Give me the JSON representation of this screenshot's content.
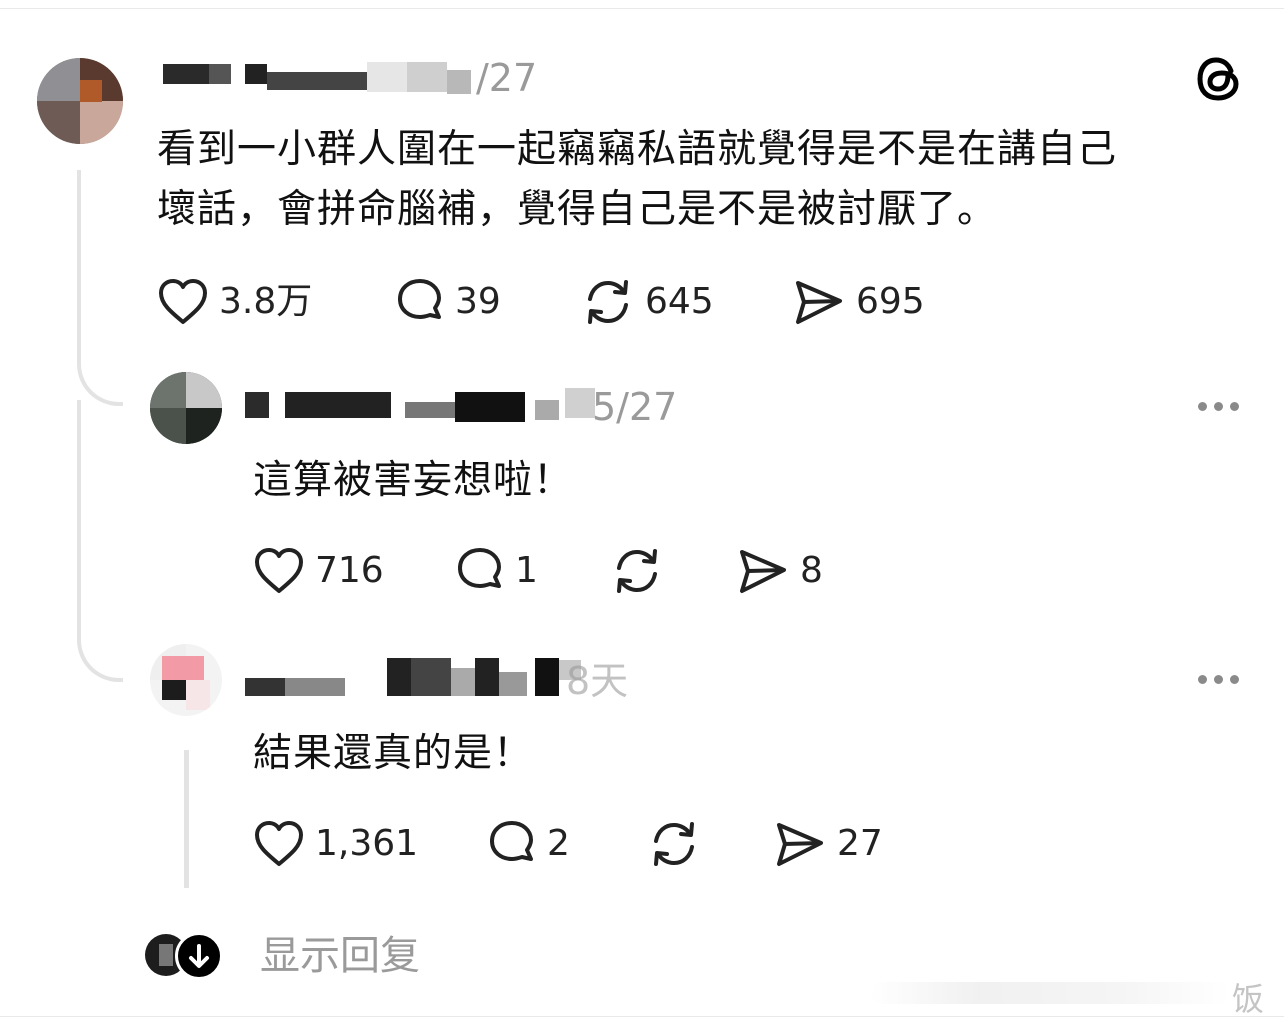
{
  "post": {
    "date": "/27",
    "text_lines": [
      "看到一小群人圍在一起竊竊私語就覺得是不是在講自己",
      "壞話，會拼命腦補，覺得自己是不是被討厭了。"
    ],
    "likes": "3.8万",
    "comments": "39",
    "reposts": "645",
    "shares": "695"
  },
  "reply1": {
    "date": "5/27",
    "text": "這算被害妄想啦！",
    "likes": "716",
    "comments": "1",
    "shares": "8"
  },
  "reply2": {
    "date": "8天",
    "text": "結果還真的是！",
    "likes": "1,361",
    "comments": "2",
    "shares": "27"
  },
  "footer": {
    "show_replies": "显示回复",
    "watermark": "饭"
  },
  "icons": [
    "threads-logo-icon",
    "heart-icon",
    "comment-icon",
    "repost-icon",
    "share-icon",
    "more-icon",
    "arrow-down-icon"
  ],
  "colors": {
    "thread_line": "#e3e3e3",
    "muted_text": "#9a9a9a"
  }
}
